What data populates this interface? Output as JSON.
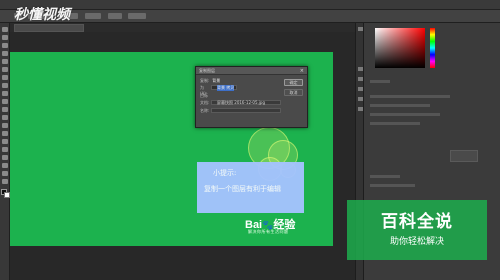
{
  "watermark": {
    "text": "秒懂视频"
  },
  "dialog": {
    "title": "复制图层",
    "close_icon": "×",
    "rows": [
      {
        "label": "复制:",
        "value": "背景"
      },
      {
        "label": "为(A):",
        "value": "背景 拷贝"
      },
      {
        "label": "目标",
        "value": ""
      },
      {
        "label": "文档:",
        "value": "屏幕快照 2016-12-05.jpg"
      },
      {
        "label": "名称:",
        "value": ""
      }
    ],
    "ok_label": "确定",
    "cancel_label": "取消"
  },
  "tip": {
    "title": "小提示:",
    "text": "复制一个图层有利于编辑"
  },
  "baidu": {
    "logo_text": "Bai",
    "logo_paw": "🐾",
    "logo_suffix": "经验",
    "subtitle": "解决你所有生活问题"
  },
  "brand": {
    "main": "百科全说",
    "sub": "助你轻松解决"
  },
  "colors": {
    "canvas_green": "#1cb24e",
    "tip_blue": "#a5c3ff",
    "ui_dark": "#2b2b2b"
  }
}
